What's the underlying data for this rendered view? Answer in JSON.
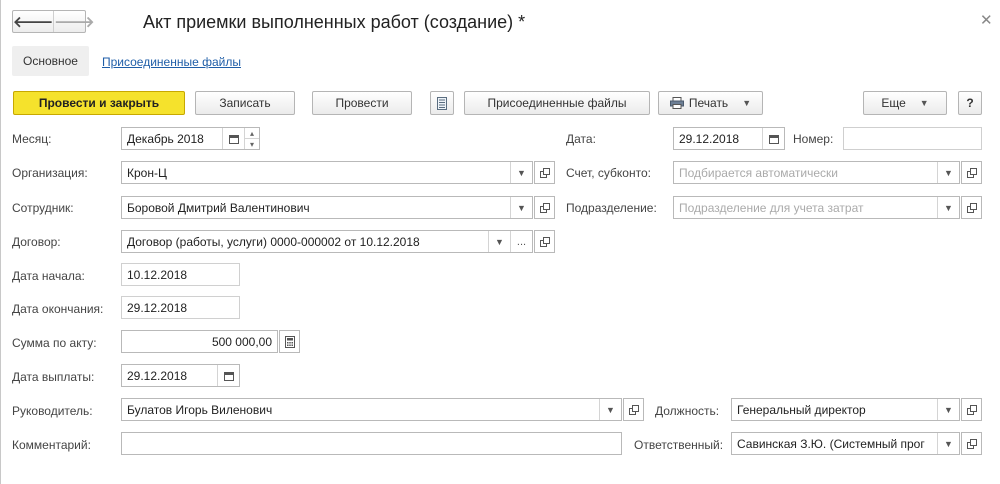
{
  "window": {
    "title": "Акт приемки выполненных работ (создание) *"
  },
  "nav": {
    "back": "🡐",
    "forward": "🡒"
  },
  "tabs": {
    "main": "Основное",
    "files": "Присоединенные файлы"
  },
  "toolbar": {
    "post_close": "Провести и закрыть",
    "save": "Записать",
    "post": "Провести",
    "attached_files": "Присоединенные файлы",
    "print": "Печать",
    "more": "Еще",
    "help": "?"
  },
  "form": {
    "month": {
      "label": "Месяц:",
      "value": "Декабрь 2018"
    },
    "date": {
      "label": "Дата:",
      "value": "29.12.2018"
    },
    "number": {
      "label": "Номер:",
      "value": ""
    },
    "organization": {
      "label": "Организация:",
      "value": "Крон-Ц"
    },
    "account": {
      "label": "Счет, субконто:",
      "placeholder": "Подбирается автоматически"
    },
    "employee": {
      "label": "Сотрудник:",
      "value": "Боровой Дмитрий Валентинович"
    },
    "department": {
      "label": "Подразделение:",
      "placeholder": "Подразделение для учета затрат"
    },
    "contract": {
      "label": "Договор:",
      "value": "Договор (работы, услуги) 0000-000002 от 10.12.2018"
    },
    "start_date": {
      "label": "Дата начала:",
      "value": "10.12.2018"
    },
    "end_date": {
      "label": "Дата окончания:",
      "value": "29.12.2018"
    },
    "amount": {
      "label": "Сумма по акту:",
      "value": "500 000,00"
    },
    "pay_date": {
      "label": "Дата выплаты:",
      "value": "29.12.2018"
    },
    "manager": {
      "label": "Руководитель:",
      "value": "Булатов Игорь Виленович"
    },
    "position": {
      "label": "Должность:",
      "value": "Генеральный директор"
    },
    "comment": {
      "label": "Комментарий:",
      "value": ""
    },
    "responsible": {
      "label": "Ответственный:",
      "value": "Савинская З.Ю. (Системный прог"
    }
  },
  "icons": {
    "dropdown": "chevron-down-icon",
    "open": "open-window-icon",
    "calendar": "calendar-icon",
    "calculator": "calculator-icon",
    "printer": "printer-icon",
    "document": "document-icon"
  },
  "colors": {
    "primary_button": "#f5e22c",
    "link": "#1f5ea8"
  }
}
